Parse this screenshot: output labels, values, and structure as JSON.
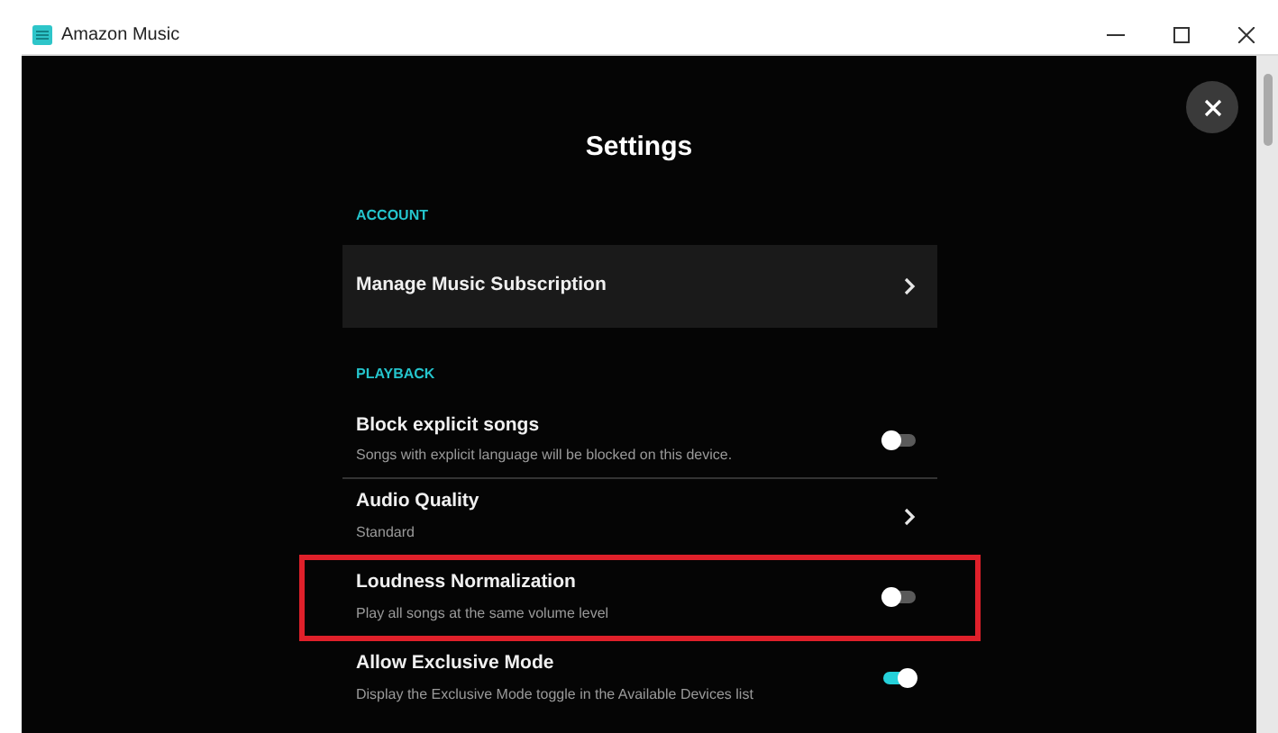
{
  "window": {
    "title": "Amazon Music"
  },
  "settings": {
    "title": "Settings",
    "sections": [
      {
        "heading": "ACCOUNT",
        "items": [
          {
            "kind": "link",
            "label": "Manage Music Subscription",
            "highlighted": false
          }
        ]
      },
      {
        "heading": "PLAYBACK",
        "items": [
          {
            "kind": "toggle",
            "label": "Block explicit songs",
            "description": "Songs with explicit language will be blocked on this device.",
            "on": false,
            "highlighted": false
          },
          {
            "kind": "link",
            "label": "Audio Quality",
            "description": "Standard",
            "highlighted": false
          },
          {
            "kind": "toggle",
            "label": "Loudness Normalization",
            "description": "Play all songs at the same volume level",
            "on": false,
            "highlighted": true
          },
          {
            "kind": "toggle",
            "label": "Allow Exclusive Mode",
            "description": "Display the Exclusive Mode toggle in the Available Devices list",
            "on": true,
            "highlighted": false
          }
        ]
      }
    ]
  }
}
